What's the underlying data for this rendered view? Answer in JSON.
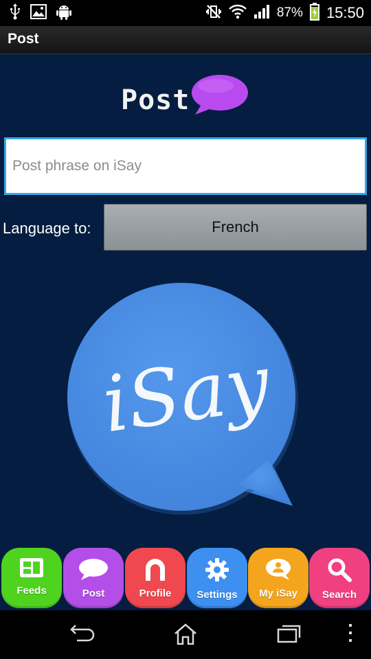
{
  "status_bar": {
    "battery": "87%",
    "time": "15:50",
    "icons": [
      "usb-icon",
      "image-icon",
      "android-icon",
      "vibrate-off-icon",
      "wifi-icon",
      "signal-icon",
      "battery-charging-icon"
    ]
  },
  "action_bar": {
    "title": "Post"
  },
  "main": {
    "heading": "Post",
    "phrase_placeholder": "Post phrase on iSay",
    "language_label": "Language to:",
    "language_value": "French",
    "logo_text": "iSay"
  },
  "bottom_nav": {
    "items": [
      {
        "label": "Feeds",
        "color": "#4fd31f",
        "icon": "feeds-icon"
      },
      {
        "label": "Post",
        "color": "#b44ee8",
        "icon": "speech-bubble-icon"
      },
      {
        "label": "Profile",
        "color": "#f0484f",
        "icon": "profile-icon"
      },
      {
        "label": "Settings",
        "color": "#3d8ff0",
        "icon": "gear-icon"
      },
      {
        "label": "My iSay",
        "color": "#f5a51d",
        "icon": "my-isay-icon"
      },
      {
        "label": "Search",
        "color": "#f0407f",
        "icon": "search-icon"
      }
    ]
  },
  "colors": {
    "background": "#041d40",
    "logo_bubble": "#4a8ee6",
    "heading_bubble": "#b94af0",
    "input_border": "#39a7e6"
  }
}
